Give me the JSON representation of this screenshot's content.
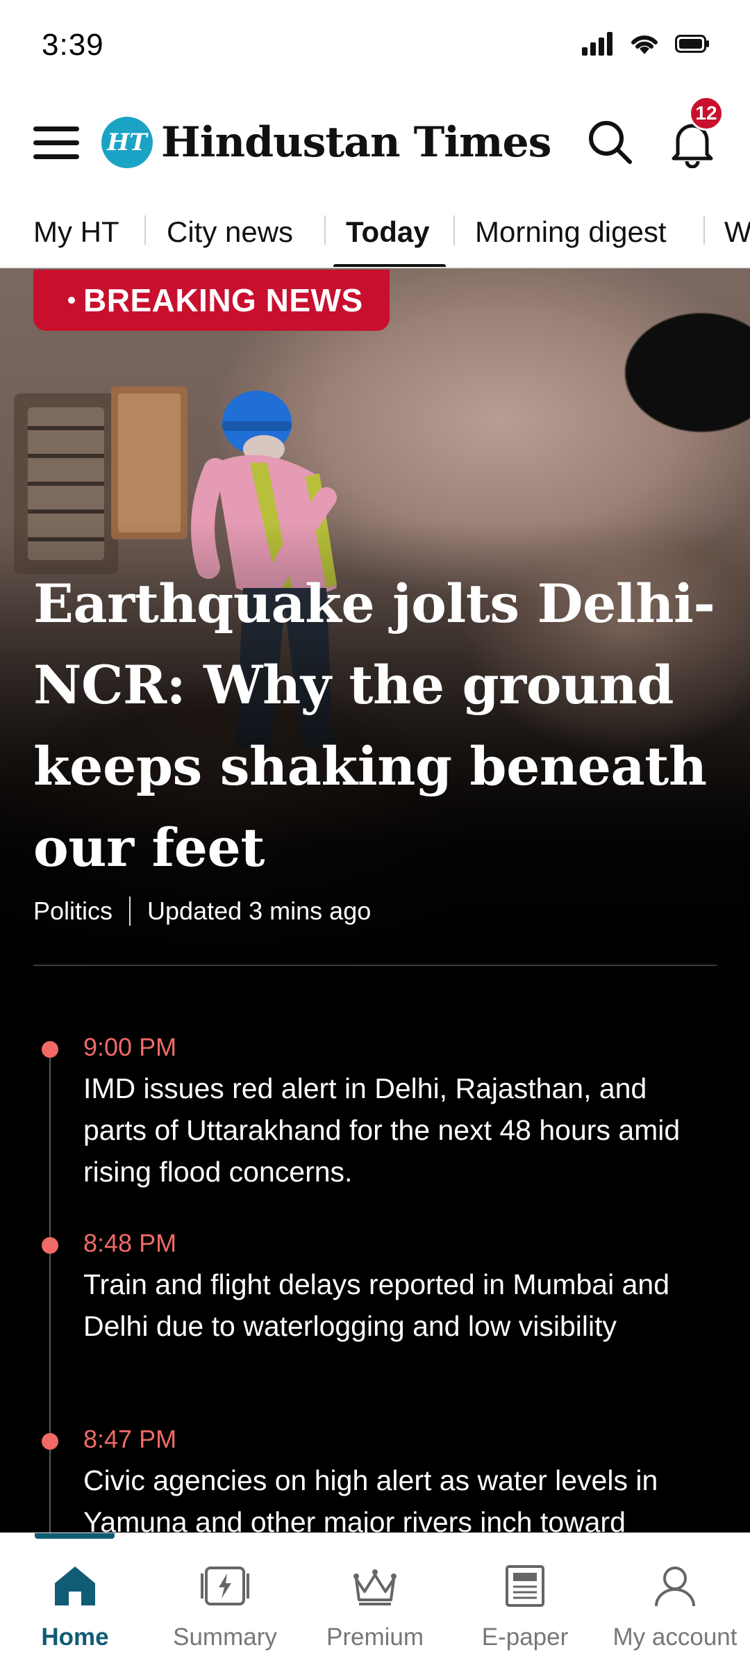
{
  "status_bar": {
    "time": "3:39"
  },
  "header": {
    "logo_mark": "HT",
    "logo_text": "Hindustan Times",
    "notification_count": "12"
  },
  "tabs": [
    {
      "label": "My HT"
    },
    {
      "label": "City news"
    },
    {
      "label": "Today",
      "active": true
    },
    {
      "label": "Morning digest"
    },
    {
      "label": "W"
    }
  ],
  "hero": {
    "badge": "BREAKING NEWS",
    "headline": "Earthquake jolts Delhi-NCR: Why the ground keeps shaking beneath our feet",
    "category": "Politics",
    "updated": "Updated 3 mins ago"
  },
  "timeline": [
    {
      "time": "9:00 PM",
      "text": "IMD issues red alert in Delhi, Rajasthan, and parts of Uttarakhand for the next 48 hours amid rising flood concerns."
    },
    {
      "time": "8:48 PM",
      "text": "Train and flight delays reported in Mumbai and Delhi due to waterlogging and low visibility"
    },
    {
      "time": "8:47 PM",
      "text": "Civic agencies on high alert as water levels in Yamuna and other major rivers inch toward"
    }
  ],
  "bottom_nav": [
    {
      "label": "Home",
      "icon": "home-icon",
      "active": true
    },
    {
      "label": "Summary",
      "icon": "summary-icon"
    },
    {
      "label": "Premium",
      "icon": "crown-icon"
    },
    {
      "label": "E-paper",
      "icon": "newspaper-icon"
    },
    {
      "label": "My account",
      "icon": "account-icon"
    }
  ],
  "colors": {
    "brand_red": "#c8102e",
    "accent_teal": "#0f5c74",
    "timeline_red": "#f06b66",
    "logo_blue": "#1aa3c5"
  }
}
